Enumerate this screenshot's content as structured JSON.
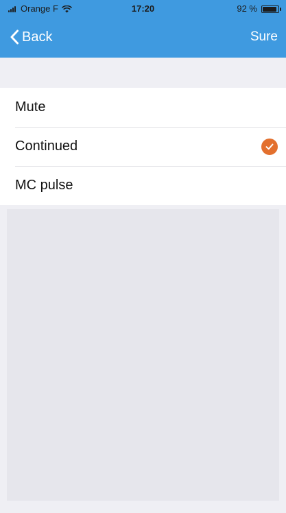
{
  "status_bar": {
    "carrier": "Orange F",
    "time": "17:20",
    "battery": "92 %",
    "battery_level": 0.92
  },
  "nav": {
    "back_label": "Back",
    "confirm_label": "Sure"
  },
  "list": {
    "items": [
      {
        "label": "Mute",
        "selected": false
      },
      {
        "label": "Continued",
        "selected": true
      },
      {
        "label": "MC pulse",
        "selected": false
      }
    ]
  },
  "colors": {
    "nav_background": "#3f9ae0",
    "check_accent": "#e3702e",
    "page_background": "#efeff4"
  },
  "icons": {
    "back": "chevron-left-icon",
    "selected": "check-circle-icon",
    "wifi": "wifi-icon",
    "signal": "signal-icon",
    "battery": "battery-icon"
  }
}
